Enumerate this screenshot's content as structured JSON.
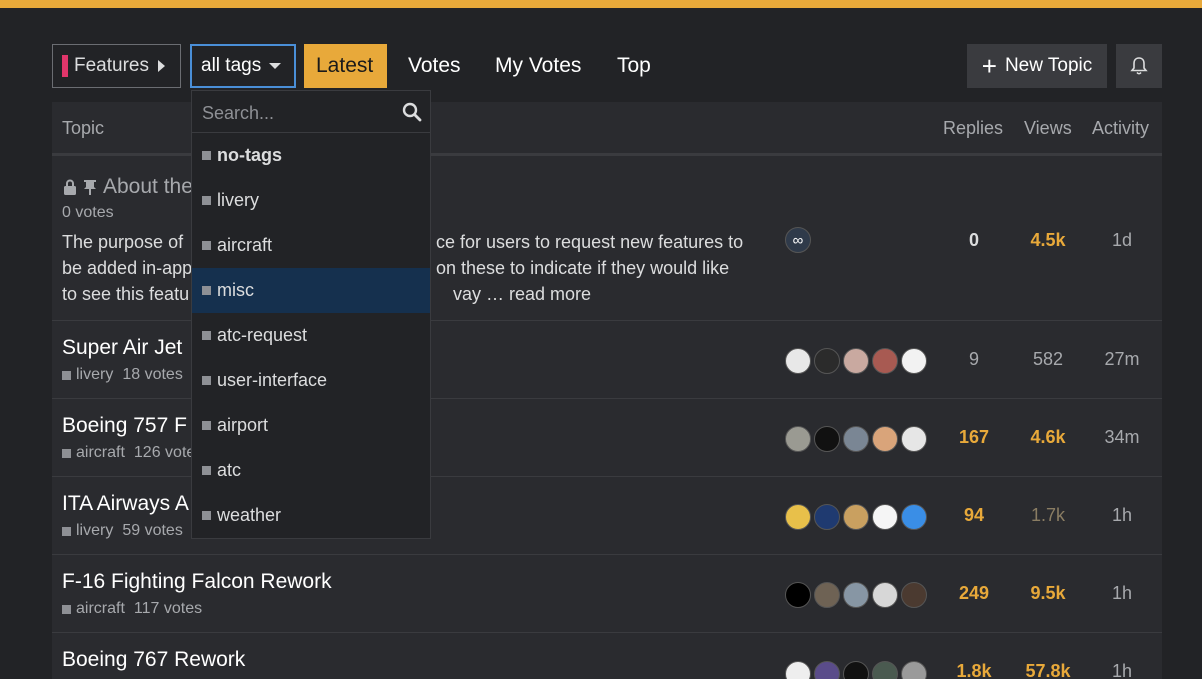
{
  "colors": {
    "accent": "#e8a93a",
    "category_features": "#e1366b",
    "focus_border": "#4a8fd8",
    "highlight": "#15304e"
  },
  "nav": {
    "category_label": "Features",
    "tag_label": "all tags",
    "tabs": [
      "Latest",
      "Votes",
      "My Votes",
      "Top"
    ],
    "active_tab": "Latest",
    "new_topic_label": "New Topic",
    "bell_icon": "bell-icon"
  },
  "tag_menu": {
    "search_placeholder": "Search...",
    "items": [
      "no-tags",
      "livery",
      "aircraft",
      "misc",
      "atc-request",
      "user-interface",
      "airport",
      "atc",
      "weather"
    ],
    "highlighted": "misc"
  },
  "table": {
    "headers": {
      "topic": "Topic",
      "replies": "Replies",
      "views": "Views",
      "activity": "Activity"
    },
    "rows": [
      {
        "title": "About the",
        "votes": "0 votes",
        "excerpt_lines": [
          "The purpose of",
          "ce for users to request new features to",
          "be added in-app",
          "on these to indicate if they would like",
          "to see this featu",
          "vay … read more"
        ],
        "replies": "0",
        "views": "4.5k",
        "activity": "1d"
      },
      {
        "title": "Super Air Jet",
        "tag": "livery",
        "votes": "18 votes",
        "replies": "9",
        "views": "582",
        "activity": "27m"
      },
      {
        "title": "Boeing 757 F",
        "tag": "aircraft",
        "votes": "126 vote",
        "replies": "167",
        "views": "4.6k",
        "activity": "34m"
      },
      {
        "title": "ITA Airways A",
        "tag": "livery",
        "votes": "59 votes",
        "replies": "94",
        "views": "1.7k",
        "activity": "1h"
      },
      {
        "title": "F-16 Fighting Falcon Rework",
        "tag": "aircraft",
        "votes": "117 votes",
        "replies": "249",
        "views": "9.5k",
        "activity": "1h"
      },
      {
        "title": "Boeing 767 Rework",
        "replies": "1.8k",
        "views": "57.8k",
        "activity": "1h"
      }
    ]
  }
}
